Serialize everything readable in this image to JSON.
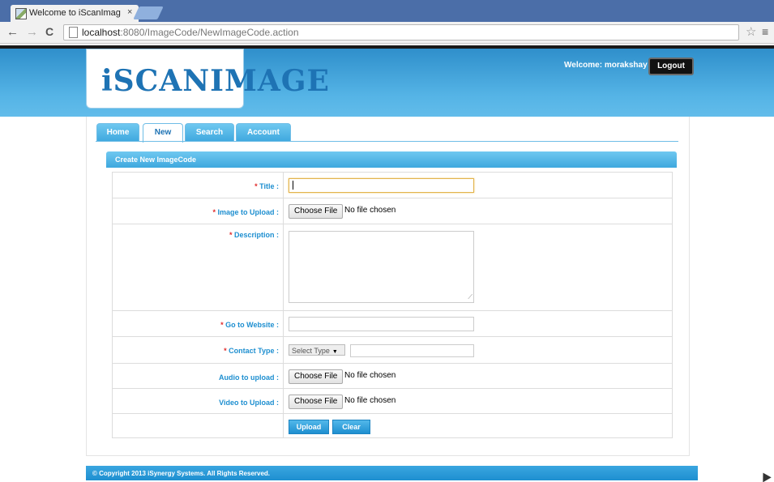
{
  "browser": {
    "tab_title": "Welcome to iScanImag",
    "tab_close": "×",
    "url_host": "localhost",
    "url_rest": ":8080/ImageCode/NewImageCode.action",
    "back": "←",
    "forward": "→",
    "reload": "C",
    "star": "☆",
    "menu": "≡"
  },
  "header": {
    "logo": "iSCANIMAGE",
    "welcome": "Welcome: morakshay",
    "logout": "Logout"
  },
  "tabs": [
    "Home",
    "New",
    "Search",
    "Account"
  ],
  "active_tab": "New",
  "panel": {
    "title": "Create New ImageCode",
    "fields": {
      "title": {
        "label": "Title :",
        "required": true,
        "value": ""
      },
      "image": {
        "label": "Image to Upload :",
        "required": true,
        "button": "Choose File",
        "status": "No file chosen"
      },
      "description": {
        "label": "Description :",
        "required": true,
        "value": ""
      },
      "website": {
        "label": "Go to Website :",
        "required": true,
        "value": ""
      },
      "contact": {
        "label": "Contact Type :",
        "required": true,
        "select": "Select Type",
        "value": ""
      },
      "audio": {
        "label": "Audio to upload :",
        "required": false,
        "button": "Choose File",
        "status": "No file chosen"
      },
      "video": {
        "label": "Video to Upload :",
        "required": false,
        "button": "Choose File",
        "status": "No file chosen"
      }
    },
    "required_mark": "* ",
    "upload": "Upload",
    "clear": "Clear"
  },
  "footer": "© Copyright 2013 iSynergy Systems. All Rights Reserved.",
  "colors": {
    "accent": "#1e8fd0",
    "required": "#e02b2b",
    "header_bg": "#55b4e6"
  }
}
